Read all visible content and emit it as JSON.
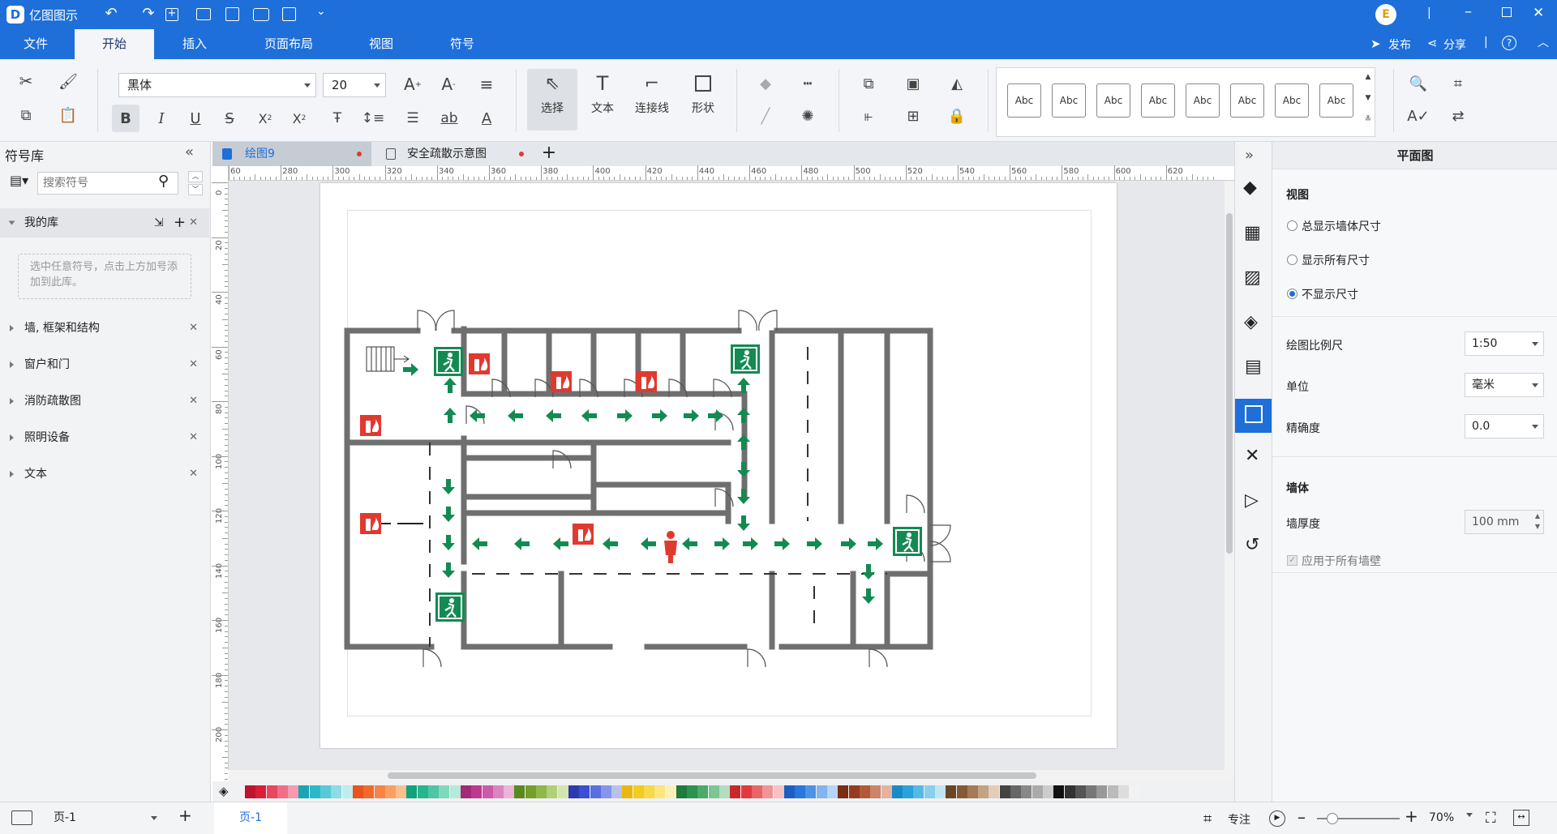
{
  "app": {
    "title": "亿图图示"
  },
  "window_controls": {
    "avatar": "E"
  },
  "menu": {
    "items": [
      "文件",
      "开始",
      "插入",
      "页面布局",
      "视图",
      "符号"
    ],
    "active": "开始",
    "publish": "发布",
    "share": "分享"
  },
  "ribbon": {
    "font_name": "黑体",
    "font_size": "20",
    "select_label": "选择",
    "text_label": "文本",
    "connector_label": "连接线",
    "shape_label": "形状",
    "style_presets": [
      "Abc",
      "Abc",
      "Abc",
      "Abc",
      "Abc",
      "Abc",
      "Abc",
      "Abc"
    ]
  },
  "library": {
    "title": "符号库",
    "search_placeholder": "搜索符号",
    "my_library": "我的库",
    "empty_hint": "选中任意符号，点击上方加号添加到此库。",
    "categories": [
      "墙, 框架和结构",
      "窗户和门",
      "消防疏散图",
      "照明设备",
      "文本"
    ]
  },
  "tabs": [
    {
      "label": "绘图9",
      "active": true
    },
    {
      "label": "安全疏散示意图",
      "active": false
    }
  ],
  "ruler": {
    "h_labels": [
      "60",
      "280",
      "300",
      "320",
      "340",
      "360",
      "380",
      "400",
      "420",
      "440",
      "460",
      "480",
      "500",
      "520",
      "540",
      "560",
      "580",
      "600",
      "620"
    ],
    "v_labels": [
      "0",
      "20",
      "40",
      "60",
      "80",
      "100",
      "120",
      "140",
      "160",
      "180",
      "200"
    ]
  },
  "properties": {
    "title": "平面图",
    "view_section": "视图",
    "view_options": [
      {
        "label": "总显示墙体尺寸",
        "selected": false
      },
      {
        "label": "显示所有尺寸",
        "selected": false
      },
      {
        "label": "不显示尺寸",
        "selected": true
      }
    ],
    "scale_label": "绘图比例尺",
    "scale_value": "1:50",
    "unit_label": "单位",
    "unit_value": "毫米",
    "precision_label": "精确度",
    "precision_value": "0.0",
    "wall_section": "墙体",
    "wall_thickness_label": "墙厚度",
    "wall_thickness_value": "100 mm",
    "apply_all_label": "应用于所有墙壁"
  },
  "status": {
    "page_dropdown": "页-1",
    "page_tab": "页-1",
    "focus_label": "专注",
    "zoom": "70%"
  },
  "colors": {
    "brand": "#1e6fd9",
    "exit_green": "#138a52",
    "fire_red": "#e03a30",
    "wall_gray": "#6f6f6f"
  }
}
